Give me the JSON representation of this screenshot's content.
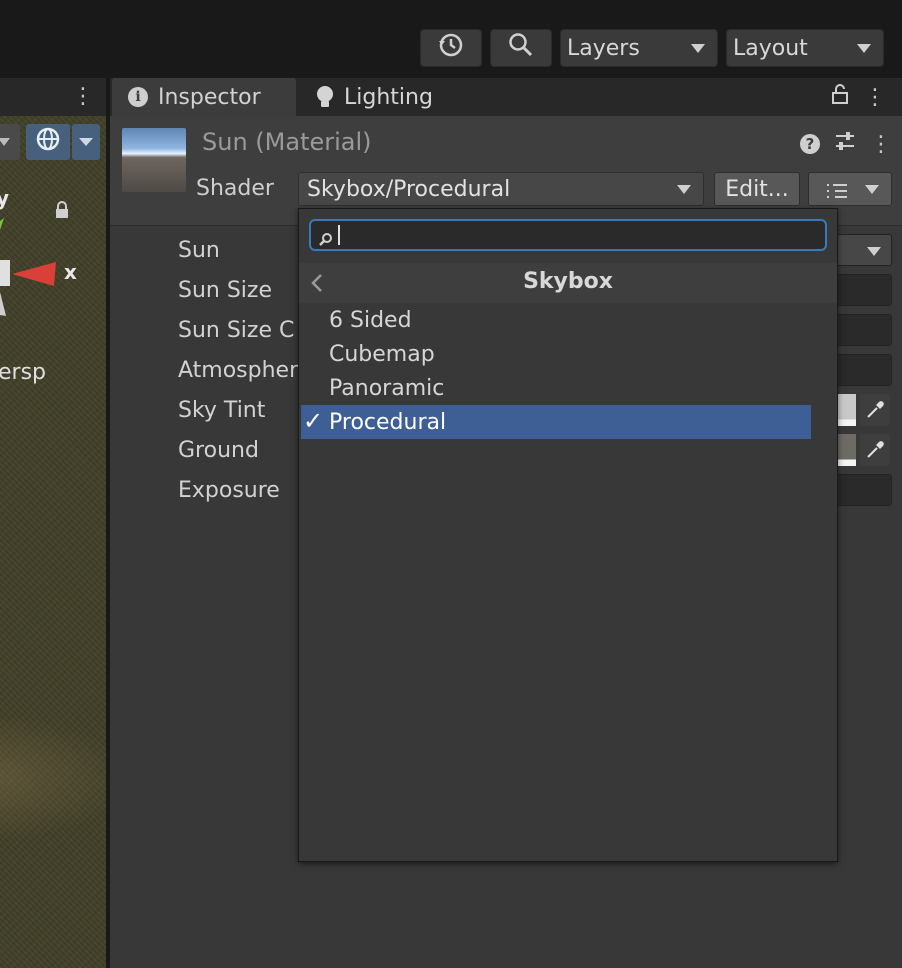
{
  "toolbar": {
    "history_icon": "history-icon",
    "search_icon": "search-icon",
    "layers_label": "Layers",
    "layout_label": "Layout"
  },
  "scene": {
    "axis_y": "y",
    "axis_x": "x",
    "persp_label": "ersp"
  },
  "tabs": [
    {
      "label": "Inspector",
      "icon": "info-icon"
    },
    {
      "label": "Lighting",
      "icon": "bulb-icon"
    }
  ],
  "material": {
    "title": "Sun (Material)",
    "shader_label": "Shader",
    "shader_value": "Skybox/Procedural",
    "edit_label": "Edit..."
  },
  "properties": [
    "Sun",
    "Sun Size",
    "Sun Size C",
    "Atmospher",
    "Sky Tint",
    "Ground",
    "Exposure"
  ],
  "popup": {
    "search_value": "",
    "nav_title": "Skybox",
    "items": [
      "6 Sided",
      "Cubemap",
      "Panoramic",
      "Procedural"
    ],
    "selected": "Procedural",
    "check_mark": "✓"
  },
  "colors": {
    "accent": "#3a79bb",
    "selection": "#3e5f96"
  }
}
